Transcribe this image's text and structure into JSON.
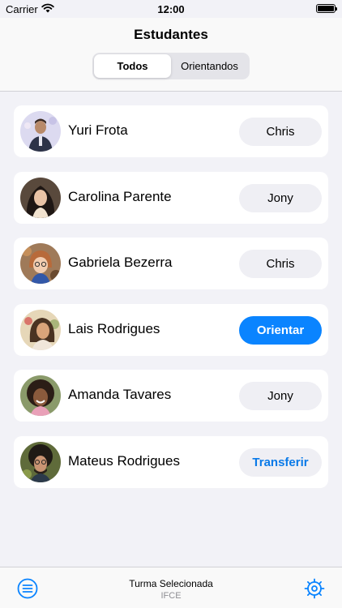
{
  "status_bar": {
    "carrier": "Carrier",
    "time": "12:00",
    "wifi_icon": "wifi-icon",
    "battery_icon": "battery-icon"
  },
  "nav": {
    "title": "Estudantes",
    "segments": [
      {
        "label": "Todos",
        "selected": true
      },
      {
        "label": "Orientandos",
        "selected": false
      }
    ]
  },
  "students": [
    {
      "name": "Yuri Frota",
      "action": "Chris",
      "style": "neutral"
    },
    {
      "name": "Carolina Parente",
      "action": "Jony",
      "style": "neutral"
    },
    {
      "name": "Gabriela Bezerra",
      "action": "Chris",
      "style": "neutral"
    },
    {
      "name": "Lais Rodrigues",
      "action": "Orientar",
      "style": "primary"
    },
    {
      "name": "Amanda Tavares",
      "action": "Jony",
      "style": "neutral"
    },
    {
      "name": "Mateus Rodrigues",
      "action": "Transferir",
      "style": "link"
    }
  ],
  "bottom_bar": {
    "title": "Turma Selecionada",
    "subtitle": "IFCE",
    "left_icon": "menu-icon",
    "right_icon": "gear-icon"
  },
  "colors": {
    "accent": "#0a84ff",
    "link": "#0a7ae8",
    "background": "#f2f2f7"
  }
}
